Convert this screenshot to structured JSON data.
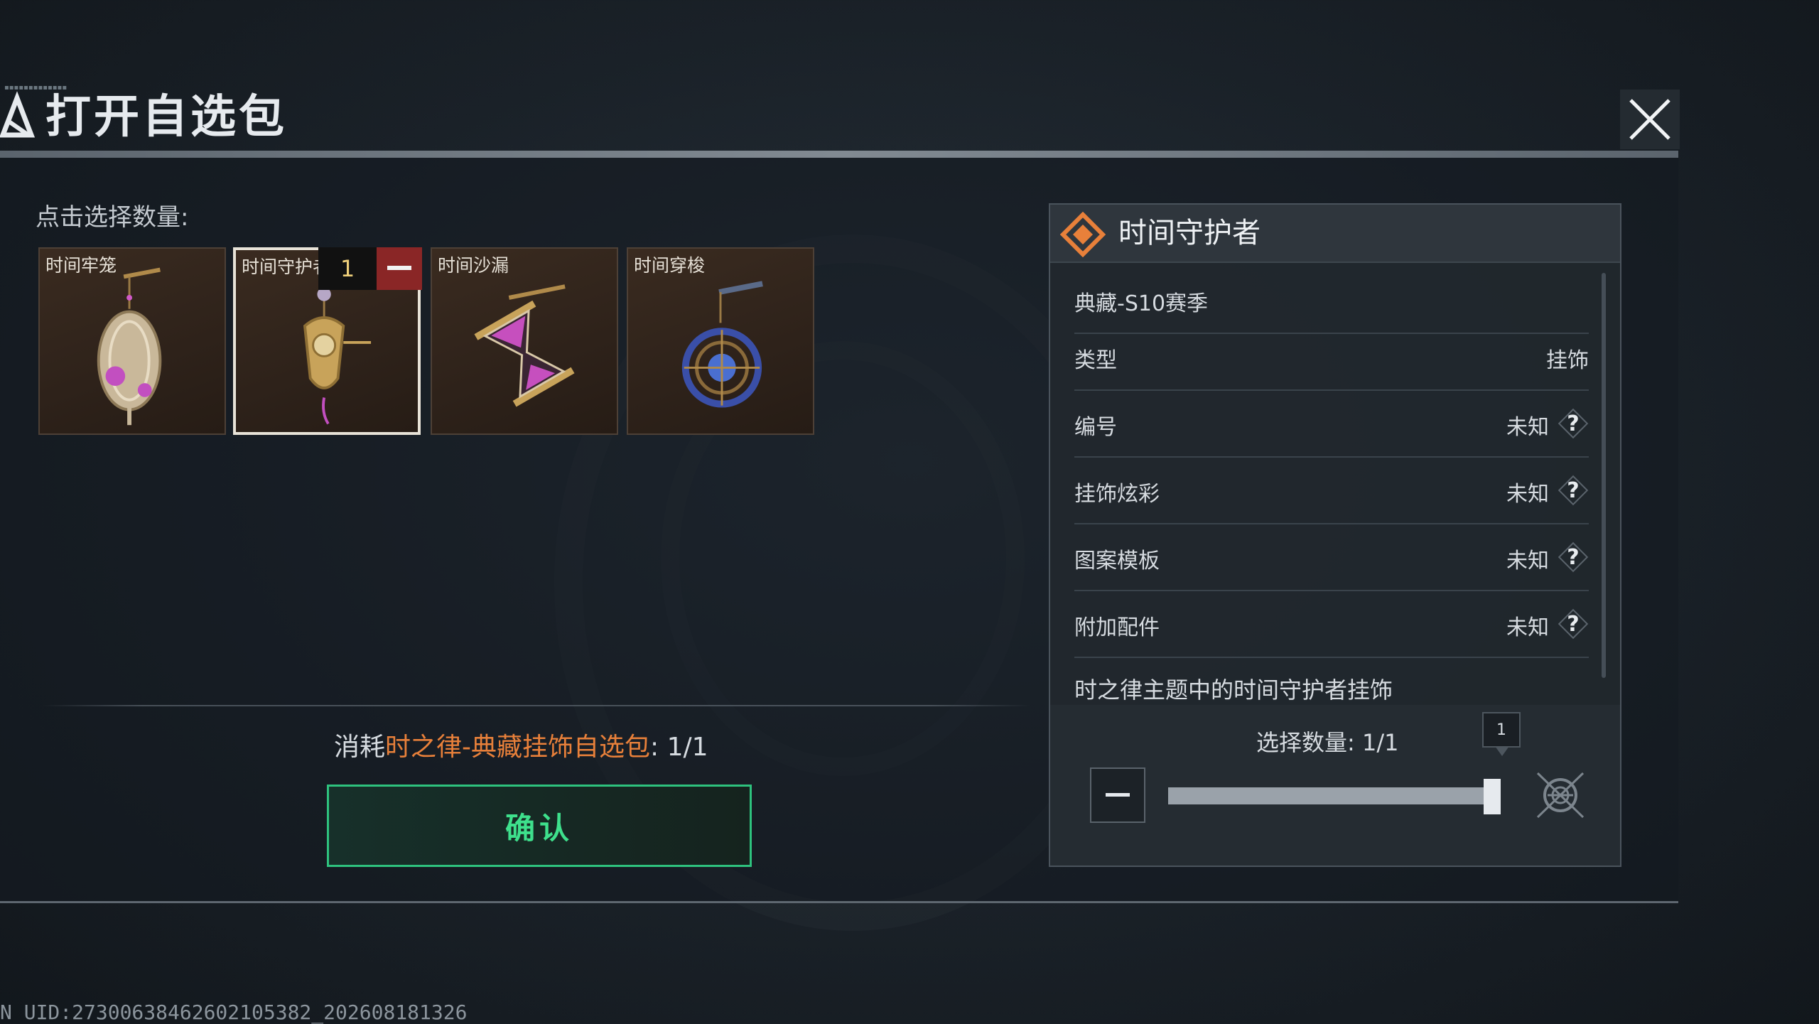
{
  "dialog": {
    "title": "打开自选包",
    "hint": "点击选择数量:",
    "close_icon": "close-icon"
  },
  "items": [
    {
      "name": "时间牢笼",
      "selected": false
    },
    {
      "name": "时间守护者",
      "selected": true,
      "count": "1"
    },
    {
      "name": "时间沙漏",
      "selected": false
    },
    {
      "name": "时间穿梭",
      "selected": false
    }
  ],
  "consume": {
    "prefix": "消耗",
    "item": "时之律-典藏挂饰自选包",
    "suffix": ": 1/1"
  },
  "confirm_label": "确认",
  "detail": {
    "title": "时间守护者",
    "season": "典藏-S10赛季",
    "rows": [
      {
        "label": "类型",
        "value": "挂饰"
      },
      {
        "label": "编号",
        "value": "未知"
      },
      {
        "label": "挂饰炫彩",
        "value": "未知"
      },
      {
        "label": "图案模板",
        "value": "未知"
      },
      {
        "label": "附加配件",
        "value": "未知"
      }
    ],
    "description": "时之律主题中的时间守护者挂饰",
    "help_symbol": "?",
    "select_label": "选择数量: 1/1",
    "bubble_value": "1",
    "slider_fraction": 1.0
  },
  "uid": "N UID:27300638462602105382_202608181326",
  "colors": {
    "accent_orange": "#e8803a",
    "confirm_green": "#3ee08c",
    "minus_red": "#8a2626"
  }
}
